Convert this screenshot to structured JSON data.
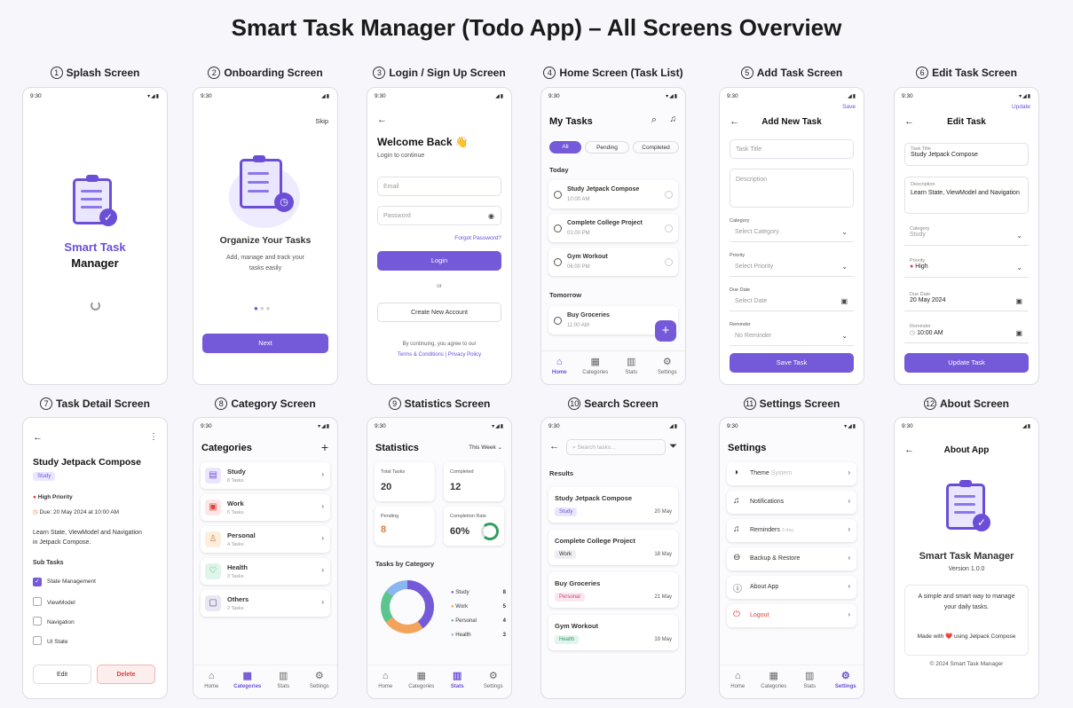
{
  "page_title": "Smart Task Manager (Todo App) – All Screens Overview",
  "time": "9:30",
  "labels": {
    "s1": "Splash Screen",
    "s2": "Onboarding Screen",
    "s3": "Login / Sign Up Screen",
    "s4": "Home Screen (Task List)",
    "s5": "Add Task Screen",
    "s6": "Edit Task Screen",
    "s7": "Task Detail Screen",
    "s8": "Category Screen",
    "s9": "Statistics Screen",
    "s10": "Search Screen",
    "s11": "Settings Screen",
    "s12": "About Screen"
  },
  "nums": {
    "s1": "1",
    "s2": "2",
    "s3": "3",
    "s4": "4",
    "s5": "5",
    "s6": "6",
    "s7": "7",
    "s8": "8",
    "s9": "9",
    "s10": "10",
    "s11": "11",
    "s12": "12"
  },
  "splash": {
    "l1": "Smart Task",
    "l2": "Manager"
  },
  "onboard": {
    "skip": "Skip",
    "title": "Organize Your Tasks",
    "desc": "Add, manage and track your tasks easily",
    "next": "Next"
  },
  "login": {
    "title": "Welcome Back 👋",
    "sub": "Login to continue",
    "email": "Email",
    "password": "Password",
    "forgot": "Forgot Password?",
    "login": "Login",
    "or": "or",
    "create": "Create New Account",
    "agree": "By continuing, you agree to our",
    "terms": "Terms & Conditions",
    "privacy": "Privacy Policy"
  },
  "home": {
    "title": "My Tasks",
    "tabs": [
      "All",
      "Pending",
      "Completed"
    ],
    "today": "Today",
    "tomorrow": "Tomorrow",
    "tasks": [
      {
        "name": "Study Jetpack Compose",
        "time": "10:00 AM"
      },
      {
        "name": "Complete College Project",
        "time": "01:00 PM"
      },
      {
        "name": "Gym Workout",
        "time": "06:00 PM"
      },
      {
        "name": "Buy Groceries",
        "time": "11:00 AM"
      }
    ]
  },
  "nav": {
    "home": "Home",
    "categories": "Categories",
    "stats": "Stats",
    "settings": "Settings"
  },
  "add": {
    "save": "Save",
    "title": "Add New Task",
    "task_title": "Task Title",
    "description": "Description",
    "category_label": "Category",
    "category": "Select Category",
    "priority_label": "Priority",
    "priority": "Select Priority",
    "due_label": "Due Date",
    "due": "Select Date",
    "reminder_label": "Reminder",
    "reminder": "No Reminder",
    "button": "Save Task"
  },
  "edit": {
    "update": "Update",
    "title": "Edit Task",
    "task_title_label": "Task Title",
    "task_title": "Study Jetpack Compose",
    "desc_label": "Description",
    "desc": "Learn State, ViewModel and Navigation",
    "category_label": "Category",
    "category": "Study",
    "priority_label": "Priority",
    "priority": "High",
    "due_label": "Due Date",
    "due": "20 May 2024",
    "reminder_label": "Reminder",
    "reminder": "10:00 AM",
    "button": "Update Task"
  },
  "detail": {
    "title": "Study Jetpack Compose",
    "tag": "Study",
    "priority": "High Priority",
    "due": "Due: 20 May 2024 at 10:00 AM",
    "desc": "Learn State, ViewModel and Navigation in Jetpack Compose.",
    "subtasks_label": "Sub Tasks",
    "subtasks": [
      "State Management",
      "ViewModel",
      "Navigation",
      "UI State"
    ],
    "edit": "Edit",
    "delete": "Delete"
  },
  "categories": {
    "title": "Categories",
    "items": [
      {
        "name": "Study",
        "count": "8 Tasks"
      },
      {
        "name": "Work",
        "count": "5 Tasks"
      },
      {
        "name": "Personal",
        "count": "4 Tasks"
      },
      {
        "name": "Health",
        "count": "3 Tasks"
      },
      {
        "name": "Others",
        "count": "2 Tasks"
      }
    ]
  },
  "stats": {
    "title": "Statistics",
    "period": "This Week",
    "total_label": "Total Tasks",
    "total": "20",
    "completed_label": "Completed",
    "completed": "12",
    "pending_label": "Pending",
    "pending": "8",
    "rate_label": "Completion Rate",
    "rate": "60%",
    "by_cat": "Tasks by Category",
    "legend": [
      {
        "name": "Study",
        "value": "8",
        "color": "#7459d9"
      },
      {
        "name": "Work",
        "value": "5",
        "color": "#f2a35c"
      },
      {
        "name": "Personal",
        "value": "4",
        "color": "#5cc48d"
      },
      {
        "name": "Health",
        "value": "3",
        "color": "#8ab6f0"
      }
    ]
  },
  "search": {
    "placeholder": "Search tasks...",
    "results": "Results",
    "items": [
      {
        "name": "Study Jetpack Compose",
        "tag": "Study",
        "date": "20 May"
      },
      {
        "name": "Complete College Project",
        "tag": "Work",
        "date": "18 May"
      },
      {
        "name": "Buy Groceries",
        "tag": "Personal",
        "date": "21 May"
      },
      {
        "name": "Gym Workout",
        "tag": "Health",
        "date": "19 May"
      }
    ]
  },
  "settings": {
    "title": "Settings",
    "theme": "Theme",
    "theme_val": "System",
    "notifications": "Notifications",
    "reminders": "Reminders",
    "reminders_val": "3 day",
    "backup": "Backup & Restore",
    "about": "About App",
    "logout": "Logout"
  },
  "about": {
    "title": "About App",
    "name": "Smart Task Manager",
    "version": "Version 1.0.0",
    "desc": "A simple and smart way to manage your daily tasks.",
    "made": "Made with ❤️ using Jetpack Compose",
    "copy": "© 2024 Smart Task Manager"
  }
}
